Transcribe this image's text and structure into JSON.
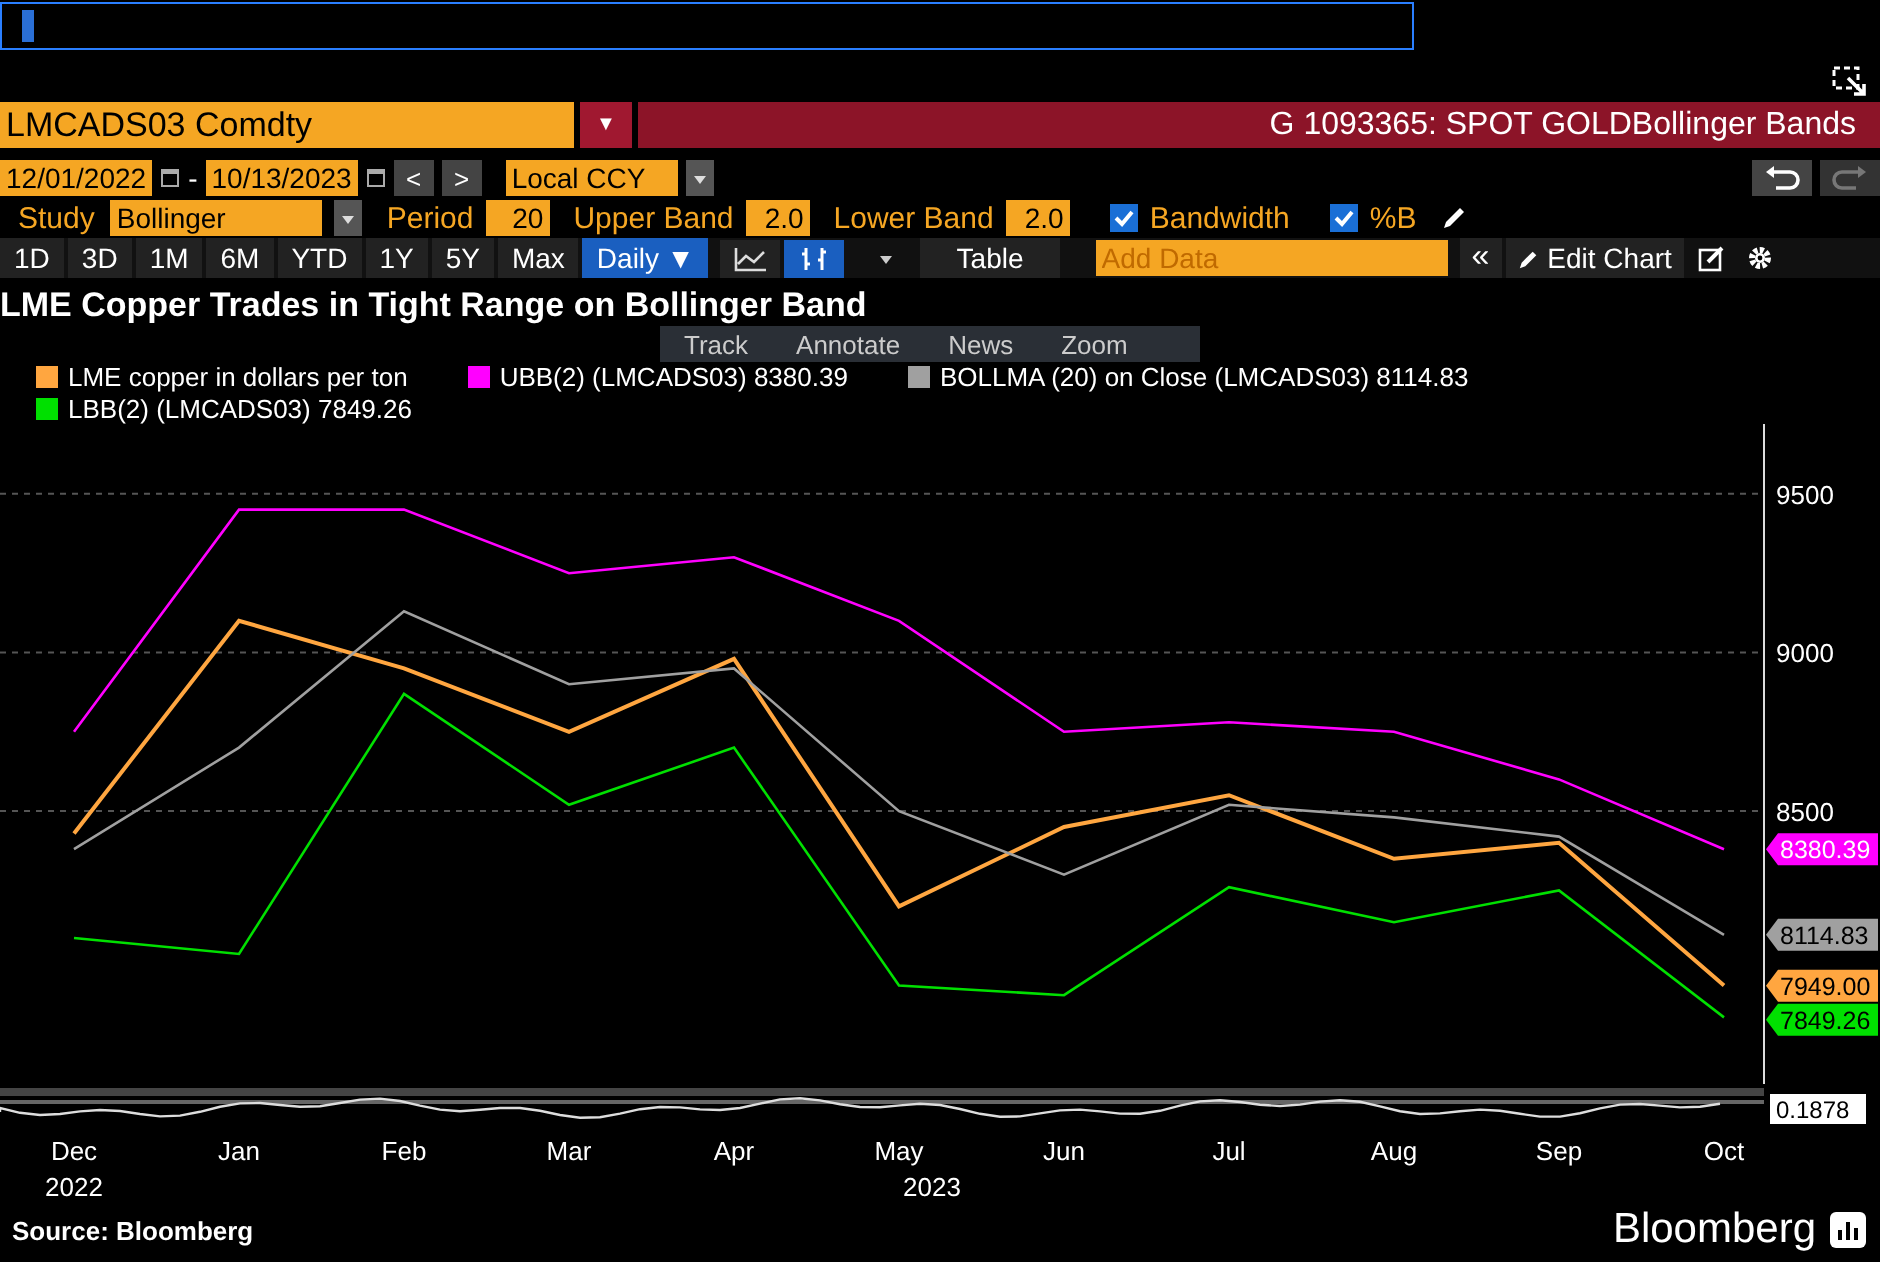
{
  "security": {
    "ticker": "LMCADS03 Comdty",
    "caret": "▼",
    "title": "G 1093365: SPOT GOLDBollinger Bands"
  },
  "range": {
    "start": "12/01/2022",
    "separator": "-",
    "end": "10/13/2023",
    "prev": "<",
    "next": ">",
    "currency": "Local CCY"
  },
  "study": {
    "label": "Study",
    "value": "Bollinger",
    "params": [
      {
        "label": "Period",
        "value": "20"
      },
      {
        "label": "Upper Band",
        "value": "2.0"
      },
      {
        "label": "Lower Band",
        "value": "2.0"
      }
    ],
    "checks": [
      {
        "label": "Bandwidth",
        "checked": true
      },
      {
        "label": "%B",
        "checked": true
      }
    ]
  },
  "periods": [
    {
      "label": "1D",
      "selected": false
    },
    {
      "label": "3D",
      "selected": false
    },
    {
      "label": "1M",
      "selected": false
    },
    {
      "label": "6M",
      "selected": false
    },
    {
      "label": "YTD",
      "selected": false
    },
    {
      "label": "1Y",
      "selected": false
    },
    {
      "label": "5Y",
      "selected": false
    },
    {
      "label": "Max",
      "selected": false
    }
  ],
  "frequency": {
    "label": "Daily ▼",
    "selected": true
  },
  "chart_types": [
    {
      "kind": "line",
      "selected": false
    },
    {
      "kind": "bars",
      "selected": true
    }
  ],
  "table_button": "Table",
  "add_data": {
    "placeholder": "Add Data"
  },
  "collapse": "«",
  "edit_chart": "Edit Chart",
  "chart": {
    "title": "LME Copper Trades in Tight Range on Bollinger Band",
    "tools": [
      "Track",
      "Annotate",
      "News",
      "Zoom"
    ],
    "value_tags": [
      {
        "text": "8380.39",
        "color": "#ff00ff"
      },
      {
        "text": "8114.83",
        "color": "#a0a0a0"
      },
      {
        "text": "7949.00",
        "color": "#ffa640"
      },
      {
        "text": "7849.26",
        "color": "#00e000"
      }
    ],
    "chart_data": {
      "type": "line",
      "legend": true,
      "grid": true,
      "categories": [
        "Dec",
        "Jan",
        "Feb",
        "Mar",
        "Apr",
        "May",
        "Jun",
        "Jul",
        "Aug",
        "Sep",
        "Oct"
      ],
      "series": [
        {
          "name": "LME copper in dollars per ton",
          "color": "#ffa640",
          "values": [
            8430,
            9100,
            8950,
            8750,
            8980,
            8200,
            8450,
            8550,
            8350,
            8400,
            7950
          ]
        },
        {
          "name": "UBB(2) (LMCADS03) 8380.39",
          "color": "#ff00ff",
          "values": [
            8750,
            9450,
            9450,
            9250,
            9300,
            9100,
            8750,
            8780,
            8750,
            8600,
            8380
          ]
        },
        {
          "name": "BOLLMA (20) on Close (LMCADS03) 8114.83",
          "color": "#a0a0a0",
          "values": [
            8380,
            8700,
            9130,
            8900,
            8950,
            8500,
            8300,
            8520,
            8480,
            8420,
            8110
          ]
        },
        {
          "name": "LBB(2) (LMCADS03) 7849.26",
          "color": "#00e000",
          "values": [
            8100,
            8050,
            8870,
            8520,
            8700,
            7950,
            7920,
            8260,
            8150,
            8250,
            7850
          ]
        }
      ],
      "ylim": [
        7640,
        9720
      ],
      "yticks": [
        8500,
        9000,
        9500
      ]
    },
    "years": [
      "2022",
      "2023"
    ],
    "lower_panel_reading": "0.1878"
  },
  "footer": {
    "source": "Source: Bloomberg",
    "brand": "Bloomberg"
  }
}
